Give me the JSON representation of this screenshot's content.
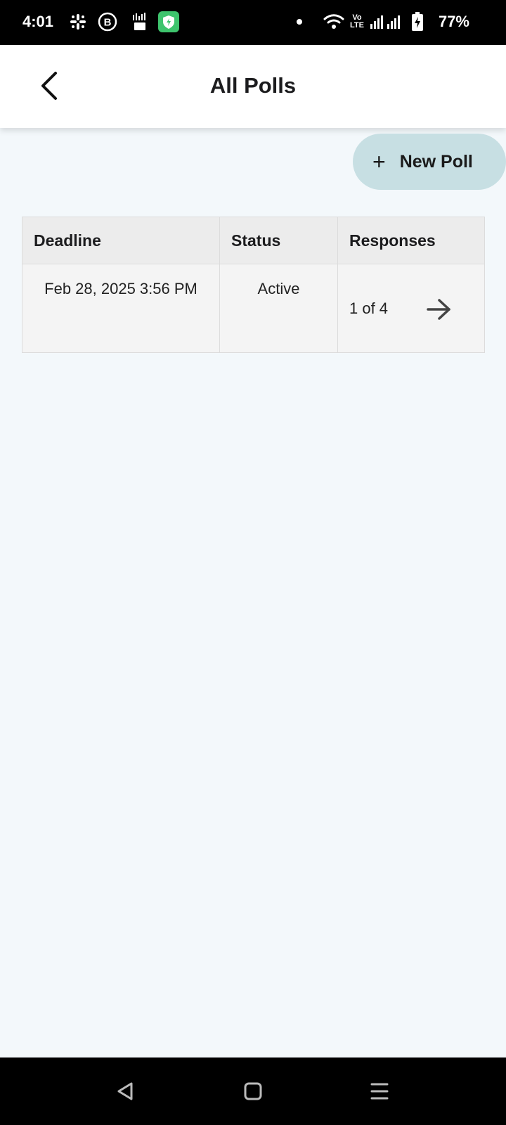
{
  "status_bar": {
    "time": "4:01",
    "battery": "77%",
    "network": "Vo LTE",
    "left_icons": [
      "slack-icon",
      "whatsapp-business-icon",
      "app-360-icon",
      "shield-app-icon"
    ],
    "right_icons": [
      "dot-icon",
      "wifi-icon",
      "signal-icon",
      "battery-charging-icon"
    ]
  },
  "header": {
    "title": "All Polls"
  },
  "actions": {
    "new_poll_plus": "+",
    "new_poll_label": "New Poll"
  },
  "table": {
    "columns": [
      "Deadline",
      "Status",
      "Responses"
    ],
    "rows": [
      {
        "deadline": "Feb 28, 2025 3:56 PM",
        "status": "Active",
        "responses": "1 of 4"
      }
    ]
  },
  "colors": {
    "page_bg": "#f3f8fb",
    "new_poll_button_bg": "#c7dfe3",
    "table_header_bg": "#ececec",
    "table_row_bg": "#f4f4f4",
    "status_green": "#3ec46d"
  }
}
